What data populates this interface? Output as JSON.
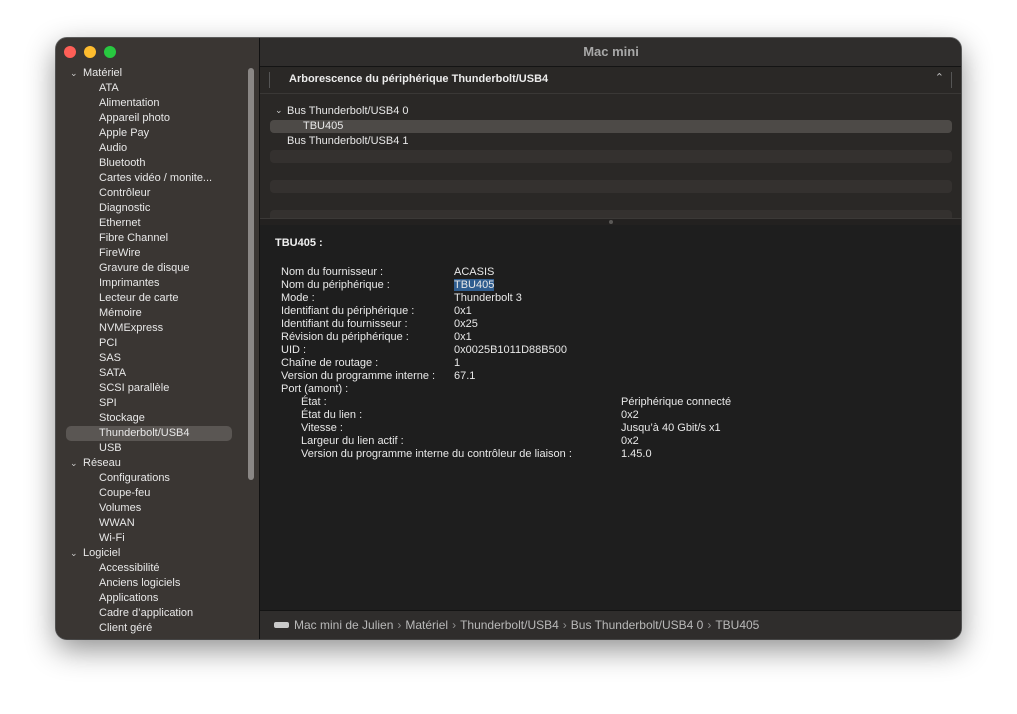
{
  "window": {
    "title": "Mac mini"
  },
  "sidebar": {
    "groups": [
      {
        "label": "Matériel",
        "items": [
          "ATA",
          "Alimentation",
          "Appareil photo",
          "Apple Pay",
          "Audio",
          "Bluetooth",
          "Cartes vidéo / monite...",
          "Contrôleur",
          "Diagnostic",
          "Ethernet",
          "Fibre Channel",
          "FireWire",
          "Gravure de disque",
          "Imprimantes",
          "Lecteur de carte",
          "Mémoire",
          "NVMExpress",
          "PCI",
          "SAS",
          "SATA",
          "SCSI parallèle",
          "SPI",
          "Stockage",
          "Thunderbolt/USB4",
          "USB"
        ]
      },
      {
        "label": "Réseau",
        "items": [
          "Configurations",
          "Coupe-feu",
          "Volumes",
          "WWAN",
          "Wi-Fi"
        ]
      },
      {
        "label": "Logiciel",
        "items": [
          "Accessibilité",
          "Anciens logiciels",
          "Applications",
          "Cadre d’application",
          "Client géré"
        ]
      }
    ],
    "selected": "Thunderbolt/USB4"
  },
  "tree": {
    "header": "Arborescence du périphérique Thunderbolt/USB4",
    "nodes": [
      {
        "label": "Bus Thunderbolt/USB4 0",
        "expanded": true,
        "level": 0
      },
      {
        "label": "TBU405",
        "level": 1,
        "selected": true
      },
      {
        "label": "Bus Thunderbolt/USB4 1",
        "level": 0
      }
    ]
  },
  "detail": {
    "title": "TBU405 :",
    "fields": [
      {
        "key": "Nom du fournisseur :",
        "value": "ACASIS"
      },
      {
        "key": "Nom du périphérique :",
        "value": "TBU405"
      },
      {
        "key": "Mode :",
        "value": "Thunderbolt 3"
      },
      {
        "key": "Identifiant du périphérique :",
        "value": "0x1"
      },
      {
        "key": "Identifiant du fournisseur :",
        "value": "0x25"
      },
      {
        "key": "Révision du périphérique :",
        "value": "0x1"
      },
      {
        "key": "UID :",
        "value": "0x0025B1011D88B500"
      },
      {
        "key": "Chaîne de routage :",
        "value": "1"
      },
      {
        "key": "Version du programme interne :",
        "value": "67.1"
      }
    ],
    "port_label": "Port (amont) :",
    "port_fields": [
      {
        "key": "État :",
        "value": "Périphérique connecté"
      },
      {
        "key": "État du lien :",
        "value": "0x2"
      },
      {
        "key": "Vitesse :",
        "value": "Jusqu’à 40 Gbit/s x1"
      },
      {
        "key": "Largeur du lien actif :",
        "value": "0x2"
      },
      {
        "key": "Version du programme interne du contrôleur de liaison :",
        "value": "1.45.0"
      }
    ]
  },
  "breadcrumb": [
    "Mac mini de Julien",
    "Matériel",
    "Thunderbolt/USB4",
    "Bus Thunderbolt/USB4 0",
    "TBU405"
  ],
  "colors": {
    "close": "#fe5f57",
    "minimize": "#febc2e",
    "zoom": "#28c840",
    "selection": "#2f5d8f"
  }
}
